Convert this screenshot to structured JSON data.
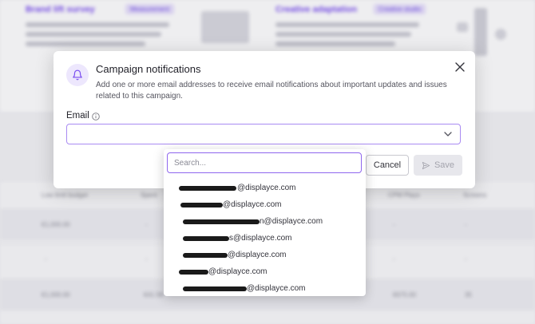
{
  "background": {
    "cards": [
      {
        "title": "Brand lift survey",
        "badge": "Measurement"
      },
      {
        "title": "Creative adaptation",
        "badge": "Creative studio"
      }
    ],
    "table_headers": [
      "Low limit budget",
      "Spent",
      "CPM Plays",
      "Screens"
    ],
    "rows": [
      [
        "€1,000.00",
        "-",
        "-",
        "-"
      ],
      [
        "-",
        "-",
        "-",
        "-"
      ],
      [
        "€1,000.00",
        "€41.58",
        "€675.00",
        "35"
      ]
    ]
  },
  "modal": {
    "title": "Campaign notifications",
    "description": "Add one or more email addresses to receive email notifications about important updates and issues related to this campaign.",
    "email_label": "Email",
    "cancel_label": "Cancel",
    "save_label": "Save"
  },
  "dropdown": {
    "search_placeholder": "Search...",
    "options": [
      "@displayce.com",
      "@displayce.com",
      "n@displayce.com",
      "s@displayce.com",
      "@displayce.com",
      "@displayce.com",
      "@displayce.com"
    ]
  },
  "colors": {
    "accent": "#8f66ee",
    "accent_light": "#ede7fd",
    "text": "#22222a"
  }
}
